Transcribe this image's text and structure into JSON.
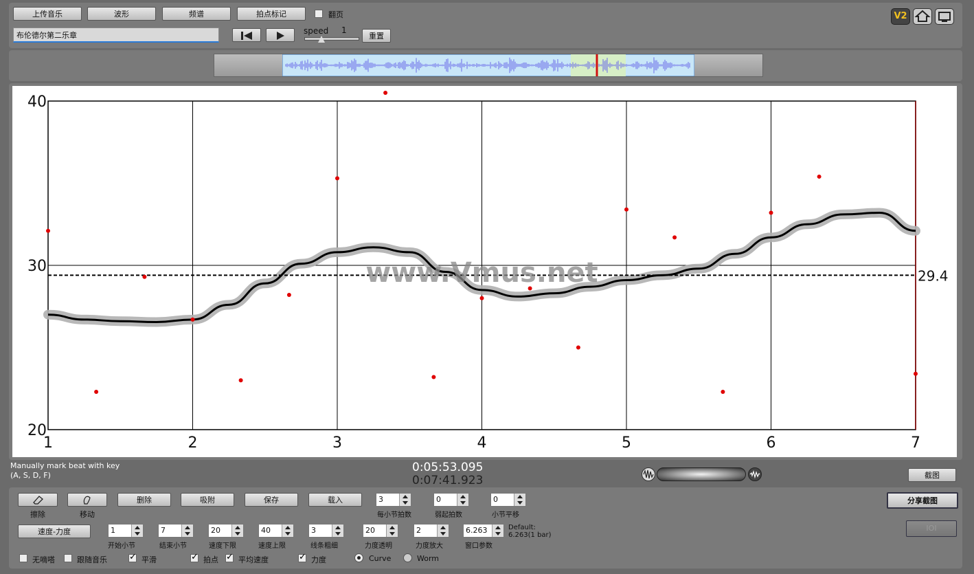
{
  "toolbar": {
    "upload_label": "上传音乐",
    "waveform_label": "波形",
    "spectrum_label": "频谱",
    "beatmark_label": "拍点标记",
    "page_turn_label": "翻页",
    "title_value": "布伦德尔第二乐章",
    "speed_label": "speed",
    "speed_value": "1",
    "reset_label": "重置"
  },
  "time": {
    "current": "0:05:53.095",
    "total": "0:07:41.923"
  },
  "hint": {
    "line1": "Manually mark beat with key",
    "line2": "(A, S, D, F)"
  },
  "screenshot_label": "截图",
  "share_label": "分享截图",
  "ioi_label": "IOI",
  "watermark": "www.Vmus.net",
  "avg_label": "29.4",
  "badges": {
    "v2": "V2"
  },
  "controls": {
    "erase_label": "擦除",
    "move_label": "移动",
    "delete_label": "删除",
    "snap_label": "吸附",
    "save_label": "保存",
    "load_label": "载入",
    "beats_per_bar": {
      "value": "3",
      "label": "每小节拍数"
    },
    "pickup_beats": {
      "value": "0",
      "label": "弱起拍数"
    },
    "bar_shift": {
      "value": "0",
      "label": "小节平移"
    },
    "tempo_dynamics_label": "速度-力度",
    "start_bar": {
      "value": "1",
      "label": "开始小节"
    },
    "end_bar": {
      "value": "7",
      "label": "结束小节"
    },
    "tempo_min": {
      "value": "20",
      "label": "速度下限"
    },
    "tempo_max": {
      "value": "40",
      "label": "速度上限"
    },
    "line_width": {
      "value": "3",
      "label": "线条粗细"
    },
    "dyn_transparency": {
      "value": "20",
      "label": "力度透明"
    },
    "dyn_zoom": {
      "value": "2",
      "label": "力度放大"
    },
    "window_param": {
      "value": "6.263",
      "label": "窗口参数"
    },
    "default_line1": "Default:",
    "default_line2": "6.263(1 bar)",
    "no_metronome": "无嘀嗒",
    "follow_music": "跟随音乐",
    "smooth": "平滑",
    "beats": "拍点",
    "avg_tempo": "平均速度",
    "dynamics": "力度",
    "curve": "Curve",
    "worm": "Worm"
  },
  "chart_data": {
    "type": "scatter",
    "xlim": [
      1,
      7
    ],
    "ylim": [
      20,
      40
    ],
    "xticks": [
      "1",
      "2",
      "3",
      "4",
      "5",
      "6",
      "7"
    ],
    "yticks": [
      "20",
      "30",
      "40"
    ],
    "grid": true,
    "average": 29.4,
    "beat_points": [
      {
        "x": 1.0,
        "y": 32.1
      },
      {
        "x": 1.333,
        "y": 22.3
      },
      {
        "x": 1.667,
        "y": 29.3
      },
      {
        "x": 2.0,
        "y": 26.7
      },
      {
        "x": 2.333,
        "y": 23.0
      },
      {
        "x": 2.667,
        "y": 28.2
      },
      {
        "x": 3.0,
        "y": 35.3
      },
      {
        "x": 3.333,
        "y": 40.5
      },
      {
        "x": 3.667,
        "y": 23.2
      },
      {
        "x": 4.0,
        "y": 28.0
      },
      {
        "x": 4.333,
        "y": 28.6
      },
      {
        "x": 4.667,
        "y": 25.0
      },
      {
        "x": 5.0,
        "y": 33.4
      },
      {
        "x": 5.333,
        "y": 31.7
      },
      {
        "x": 5.667,
        "y": 22.3
      },
      {
        "x": 6.0,
        "y": 33.2
      },
      {
        "x": 6.333,
        "y": 35.4
      },
      {
        "x": 7.0,
        "y": 23.4
      }
    ],
    "smooth_curve": [
      [
        1.0,
        27.0
      ],
      [
        1.25,
        26.7
      ],
      [
        1.5,
        26.6
      ],
      [
        1.75,
        26.55
      ],
      [
        2.0,
        26.7
      ],
      [
        2.25,
        27.6
      ],
      [
        2.5,
        28.9
      ],
      [
        2.75,
        30.1
      ],
      [
        3.0,
        30.8
      ],
      [
        3.25,
        31.1
      ],
      [
        3.5,
        30.8
      ],
      [
        3.75,
        29.6
      ],
      [
        4.0,
        28.5
      ],
      [
        4.25,
        28.1
      ],
      [
        4.5,
        28.3
      ],
      [
        4.75,
        28.7
      ],
      [
        5.0,
        29.1
      ],
      [
        5.25,
        29.4
      ],
      [
        5.5,
        29.8
      ],
      [
        5.75,
        30.7
      ],
      [
        6.0,
        31.7
      ],
      [
        6.25,
        32.5
      ],
      [
        6.5,
        33.1
      ],
      [
        6.75,
        33.2
      ],
      [
        7.0,
        32.1
      ]
    ]
  }
}
